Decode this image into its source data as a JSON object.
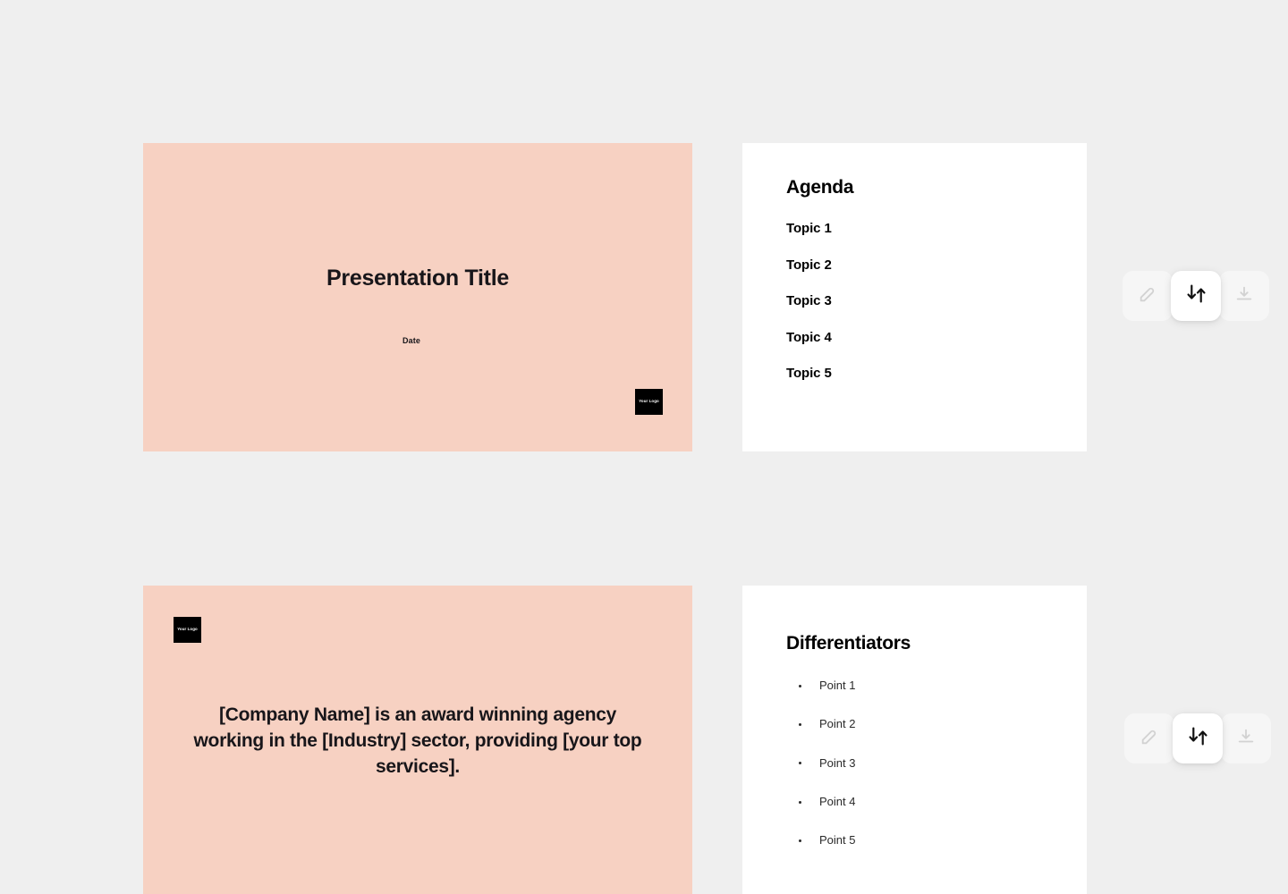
{
  "theme": {
    "page_background": "#efefef",
    "slide_pink": "#f7d1c2",
    "slide_white": "#ffffff",
    "ink": "#18161a",
    "badge_background": "#000000",
    "badge_text_color": "#ffffff"
  },
  "slides": {
    "title": {
      "name": "Title slide",
      "title": "Presentation Title",
      "date": "Date",
      "logo_label": "Your Logo"
    },
    "agenda": {
      "name": "Agenda slide",
      "heading": "Agenda",
      "items": [
        {
          "label": "Topic 1"
        },
        {
          "label": "Topic 2"
        },
        {
          "label": "Topic 3"
        },
        {
          "label": "Topic 4"
        },
        {
          "label": "Topic 5"
        }
      ]
    },
    "statement": {
      "name": "Company statement slide",
      "logo_label": "Your Logo",
      "body": "[Company Name] is an award winning agency working in the [Industry] sector, providing [your top services]."
    },
    "differentiators": {
      "name": "Differentiators slide",
      "heading": "Differentiators",
      "items": [
        {
          "label": "Point 1"
        },
        {
          "label": "Point 2"
        },
        {
          "label": "Point 3"
        },
        {
          "label": "Point 4"
        },
        {
          "label": "Point 5"
        }
      ]
    }
  },
  "controls": {
    "top": {
      "swap_icon": "swap-vertical-icon",
      "left_ghost_icon": "edit-icon",
      "download_icon": "download-icon"
    },
    "bottom": {
      "swap_icon": "swap-vertical-icon",
      "left_ghost_icon": "edit-icon",
      "download_icon": "download-icon"
    }
  }
}
